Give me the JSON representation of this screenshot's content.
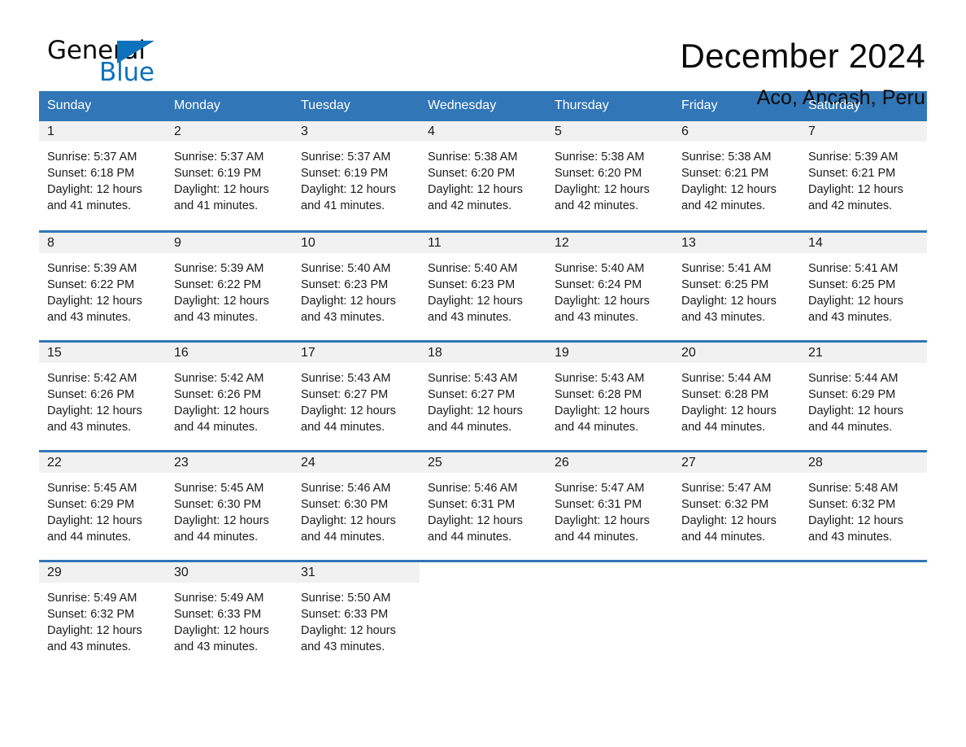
{
  "brand": {
    "word_one": "General",
    "word_two": "Blue",
    "flag_icon": "triangle-flag-icon"
  },
  "header": {
    "title": "December 2024",
    "location": "Aco, Ancash, Peru"
  },
  "theme": {
    "header_blue": "#3176b6",
    "brand_blue": "#0d72bb",
    "daynum_band": "#f1f1f1",
    "cell_background": "#ffffff",
    "text": "#1a1a1a"
  },
  "calendar": {
    "weekday_headers": [
      "Sunday",
      "Monday",
      "Tuesday",
      "Wednesday",
      "Thursday",
      "Friday",
      "Saturday"
    ],
    "weeks": [
      [
        {
          "day": "1",
          "sunrise": "Sunrise: 5:37 AM",
          "sunset": "Sunset: 6:18 PM",
          "daylight_1": "Daylight: 12 hours",
          "daylight_2": "and 41 minutes."
        },
        {
          "day": "2",
          "sunrise": "Sunrise: 5:37 AM",
          "sunset": "Sunset: 6:19 PM",
          "daylight_1": "Daylight: 12 hours",
          "daylight_2": "and 41 minutes."
        },
        {
          "day": "3",
          "sunrise": "Sunrise: 5:37 AM",
          "sunset": "Sunset: 6:19 PM",
          "daylight_1": "Daylight: 12 hours",
          "daylight_2": "and 41 minutes."
        },
        {
          "day": "4",
          "sunrise": "Sunrise: 5:38 AM",
          "sunset": "Sunset: 6:20 PM",
          "daylight_1": "Daylight: 12 hours",
          "daylight_2": "and 42 minutes."
        },
        {
          "day": "5",
          "sunrise": "Sunrise: 5:38 AM",
          "sunset": "Sunset: 6:20 PM",
          "daylight_1": "Daylight: 12 hours",
          "daylight_2": "and 42 minutes."
        },
        {
          "day": "6",
          "sunrise": "Sunrise: 5:38 AM",
          "sunset": "Sunset: 6:21 PM",
          "daylight_1": "Daylight: 12 hours",
          "daylight_2": "and 42 minutes."
        },
        {
          "day": "7",
          "sunrise": "Sunrise: 5:39 AM",
          "sunset": "Sunset: 6:21 PM",
          "daylight_1": "Daylight: 12 hours",
          "daylight_2": "and 42 minutes."
        }
      ],
      [
        {
          "day": "8",
          "sunrise": "Sunrise: 5:39 AM",
          "sunset": "Sunset: 6:22 PM",
          "daylight_1": "Daylight: 12 hours",
          "daylight_2": "and 43 minutes."
        },
        {
          "day": "9",
          "sunrise": "Sunrise: 5:39 AM",
          "sunset": "Sunset: 6:22 PM",
          "daylight_1": "Daylight: 12 hours",
          "daylight_2": "and 43 minutes."
        },
        {
          "day": "10",
          "sunrise": "Sunrise: 5:40 AM",
          "sunset": "Sunset: 6:23 PM",
          "daylight_1": "Daylight: 12 hours",
          "daylight_2": "and 43 minutes."
        },
        {
          "day": "11",
          "sunrise": "Sunrise: 5:40 AM",
          "sunset": "Sunset: 6:23 PM",
          "daylight_1": "Daylight: 12 hours",
          "daylight_2": "and 43 minutes."
        },
        {
          "day": "12",
          "sunrise": "Sunrise: 5:40 AM",
          "sunset": "Sunset: 6:24 PM",
          "daylight_1": "Daylight: 12 hours",
          "daylight_2": "and 43 minutes."
        },
        {
          "day": "13",
          "sunrise": "Sunrise: 5:41 AM",
          "sunset": "Sunset: 6:25 PM",
          "daylight_1": "Daylight: 12 hours",
          "daylight_2": "and 43 minutes."
        },
        {
          "day": "14",
          "sunrise": "Sunrise: 5:41 AM",
          "sunset": "Sunset: 6:25 PM",
          "daylight_1": "Daylight: 12 hours",
          "daylight_2": "and 43 minutes."
        }
      ],
      [
        {
          "day": "15",
          "sunrise": "Sunrise: 5:42 AM",
          "sunset": "Sunset: 6:26 PM",
          "daylight_1": "Daylight: 12 hours",
          "daylight_2": "and 43 minutes."
        },
        {
          "day": "16",
          "sunrise": "Sunrise: 5:42 AM",
          "sunset": "Sunset: 6:26 PM",
          "daylight_1": "Daylight: 12 hours",
          "daylight_2": "and 44 minutes."
        },
        {
          "day": "17",
          "sunrise": "Sunrise: 5:43 AM",
          "sunset": "Sunset: 6:27 PM",
          "daylight_1": "Daylight: 12 hours",
          "daylight_2": "and 44 minutes."
        },
        {
          "day": "18",
          "sunrise": "Sunrise: 5:43 AM",
          "sunset": "Sunset: 6:27 PM",
          "daylight_1": "Daylight: 12 hours",
          "daylight_2": "and 44 minutes."
        },
        {
          "day": "19",
          "sunrise": "Sunrise: 5:43 AM",
          "sunset": "Sunset: 6:28 PM",
          "daylight_1": "Daylight: 12 hours",
          "daylight_2": "and 44 minutes."
        },
        {
          "day": "20",
          "sunrise": "Sunrise: 5:44 AM",
          "sunset": "Sunset: 6:28 PM",
          "daylight_1": "Daylight: 12 hours",
          "daylight_2": "and 44 minutes."
        },
        {
          "day": "21",
          "sunrise": "Sunrise: 5:44 AM",
          "sunset": "Sunset: 6:29 PM",
          "daylight_1": "Daylight: 12 hours",
          "daylight_2": "and 44 minutes."
        }
      ],
      [
        {
          "day": "22",
          "sunrise": "Sunrise: 5:45 AM",
          "sunset": "Sunset: 6:29 PM",
          "daylight_1": "Daylight: 12 hours",
          "daylight_2": "and 44 minutes."
        },
        {
          "day": "23",
          "sunrise": "Sunrise: 5:45 AM",
          "sunset": "Sunset: 6:30 PM",
          "daylight_1": "Daylight: 12 hours",
          "daylight_2": "and 44 minutes."
        },
        {
          "day": "24",
          "sunrise": "Sunrise: 5:46 AM",
          "sunset": "Sunset: 6:30 PM",
          "daylight_1": "Daylight: 12 hours",
          "daylight_2": "and 44 minutes."
        },
        {
          "day": "25",
          "sunrise": "Sunrise: 5:46 AM",
          "sunset": "Sunset: 6:31 PM",
          "daylight_1": "Daylight: 12 hours",
          "daylight_2": "and 44 minutes."
        },
        {
          "day": "26",
          "sunrise": "Sunrise: 5:47 AM",
          "sunset": "Sunset: 6:31 PM",
          "daylight_1": "Daylight: 12 hours",
          "daylight_2": "and 44 minutes."
        },
        {
          "day": "27",
          "sunrise": "Sunrise: 5:47 AM",
          "sunset": "Sunset: 6:32 PM",
          "daylight_1": "Daylight: 12 hours",
          "daylight_2": "and 44 minutes."
        },
        {
          "day": "28",
          "sunrise": "Sunrise: 5:48 AM",
          "sunset": "Sunset: 6:32 PM",
          "daylight_1": "Daylight: 12 hours",
          "daylight_2": "and 43 minutes."
        }
      ],
      [
        {
          "day": "29",
          "sunrise": "Sunrise: 5:49 AM",
          "sunset": "Sunset: 6:32 PM",
          "daylight_1": "Daylight: 12 hours",
          "daylight_2": "and 43 minutes."
        },
        {
          "day": "30",
          "sunrise": "Sunrise: 5:49 AM",
          "sunset": "Sunset: 6:33 PM",
          "daylight_1": "Daylight: 12 hours",
          "daylight_2": "and 43 minutes."
        },
        {
          "day": "31",
          "sunrise": "Sunrise: 5:50 AM",
          "sunset": "Sunset: 6:33 PM",
          "daylight_1": "Daylight: 12 hours",
          "daylight_2": "and 43 minutes."
        },
        {
          "day": "",
          "sunrise": "",
          "sunset": "",
          "daylight_1": "",
          "daylight_2": ""
        },
        {
          "day": "",
          "sunrise": "",
          "sunset": "",
          "daylight_1": "",
          "daylight_2": ""
        },
        {
          "day": "",
          "sunrise": "",
          "sunset": "",
          "daylight_1": "",
          "daylight_2": ""
        },
        {
          "day": "",
          "sunrise": "",
          "sunset": "",
          "daylight_1": "",
          "daylight_2": ""
        }
      ]
    ]
  }
}
